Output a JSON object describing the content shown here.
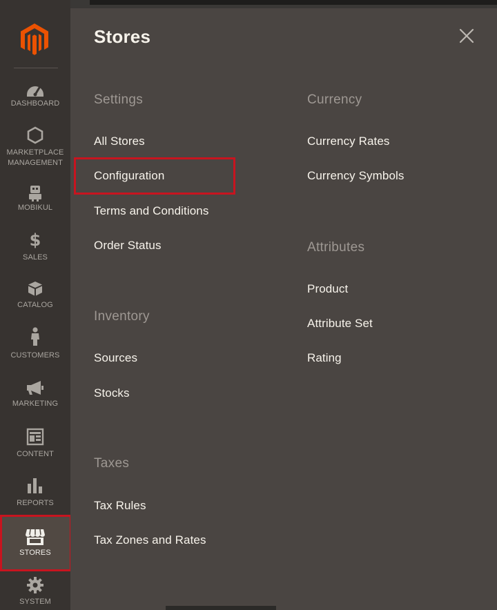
{
  "sidebar": {
    "logo": "magento-logo",
    "items": [
      {
        "label": "DASHBOARD",
        "icon": "speedometer-icon"
      },
      {
        "label": "MARKETPLACE MANAGEMENT",
        "icon": "hexagon-icon"
      },
      {
        "label": "MOBIKUL",
        "icon": "robot-icon"
      },
      {
        "label": "SALES",
        "icon": "dollar-icon"
      },
      {
        "label": "CATALOG",
        "icon": "box-icon"
      },
      {
        "label": "CUSTOMERS",
        "icon": "person-icon"
      },
      {
        "label": "MARKETING",
        "icon": "megaphone-icon"
      },
      {
        "label": "CONTENT",
        "icon": "layout-icon"
      },
      {
        "label": "REPORTS",
        "icon": "bar-chart-icon"
      },
      {
        "label": "STORES",
        "icon": "storefront-icon",
        "active": true
      },
      {
        "label": "SYSTEM",
        "icon": "gear-icon"
      }
    ]
  },
  "panel": {
    "title": "Stores",
    "close_icon": "close-icon",
    "groups": {
      "settings": {
        "title": "Settings",
        "links": [
          "All Stores",
          "Configuration",
          "Terms and Conditions",
          "Order Status"
        ]
      },
      "inventory": {
        "title": "Inventory",
        "links": [
          "Sources",
          "Stocks"
        ]
      },
      "taxes": {
        "title": "Taxes",
        "links": [
          "Tax Rules",
          "Tax Zones and Rates"
        ]
      },
      "currency": {
        "title": "Currency",
        "links": [
          "Currency Rates",
          "Currency Symbols"
        ]
      },
      "attributes": {
        "title": "Attributes",
        "links": [
          "Product",
          "Attribute Set",
          "Rating"
        ]
      }
    }
  },
  "colors": {
    "highlight": "#c8141f",
    "brand": "#eb5202",
    "panel_bg": "#4a4542",
    "sidebar_bg": "#373330"
  }
}
